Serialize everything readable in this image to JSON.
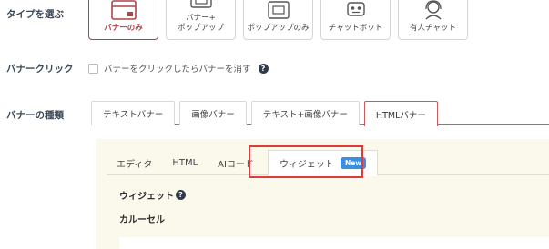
{
  "rows": {
    "type_label": "タイプを選ぶ",
    "click_label": "バナークリック",
    "kind_label": "バナーの種類"
  },
  "type_cards": [
    {
      "label": "バナーのみ",
      "icon": "banner-icon",
      "selected": true
    },
    {
      "label": "バナー+\nポップアップ",
      "icon": "banner-popup-icon",
      "selected": false
    },
    {
      "label": "ポップアップのみ",
      "icon": "popup-icon",
      "selected": false
    },
    {
      "label": "チャットボット",
      "icon": "robot-icon",
      "selected": false
    },
    {
      "label": "有人チャット",
      "icon": "agent-headset-icon",
      "selected": false
    }
  ],
  "click": {
    "checkbox_label": "バナーをクリックしたらバナーを消す",
    "checked": false,
    "help": "?"
  },
  "kind_tabs": [
    {
      "label": "テキストバナー",
      "active": false
    },
    {
      "label": "画像バナー",
      "active": false
    },
    {
      "label": "テキスト+画像バナー",
      "active": false
    },
    {
      "label": "HTMLバナー",
      "active": true
    }
  ],
  "inner_tabs": [
    {
      "label": "エディタ",
      "active": false
    },
    {
      "label": "HTML",
      "active": false
    },
    {
      "label": "AIコード",
      "active": false
    },
    {
      "label": "ウィジェット",
      "active": true,
      "badge": "New"
    }
  ],
  "widget": {
    "title": "ウィジェット",
    "help": "?",
    "subtitle": "カルーセル"
  },
  "colors": {
    "accent": "#b24148",
    "highlight": "#e03a3a",
    "badge": "#3b8ee0",
    "panel_bg": "#fbf8ec"
  }
}
